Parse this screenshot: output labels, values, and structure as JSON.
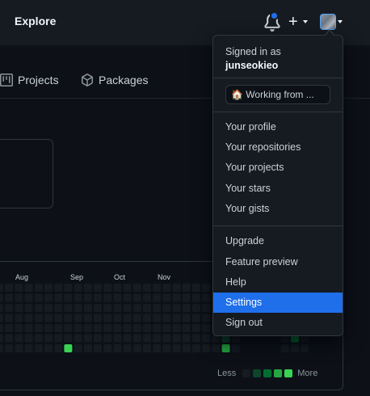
{
  "header": {
    "explore_label": "Explore",
    "plus_label": "+",
    "accent_color": "#1f6feb"
  },
  "tabs": [
    {
      "label": "Projects",
      "icon": "project-icon"
    },
    {
      "label": "Packages",
      "icon": "package-icon"
    }
  ],
  "contributions": {
    "months": [
      "Aug",
      "Sep",
      "Oct",
      "Nov"
    ],
    "legend_less": "Less",
    "legend_more": "More",
    "levels": [
      "#161b22",
      "#0e4429",
      "#006d32",
      "#26a641",
      "#39d353"
    ]
  },
  "menu": {
    "signed_in_label": "Signed in as",
    "username": "junseokieo",
    "status_emoji": "🏠",
    "status_text": "Working from ...",
    "group1": [
      "Your profile",
      "Your repositories",
      "Your projects",
      "Your stars",
      "Your gists"
    ],
    "group2": [
      "Upgrade",
      "Feature preview",
      "Help",
      "Settings",
      "Sign out"
    ],
    "active_item": "Settings"
  }
}
